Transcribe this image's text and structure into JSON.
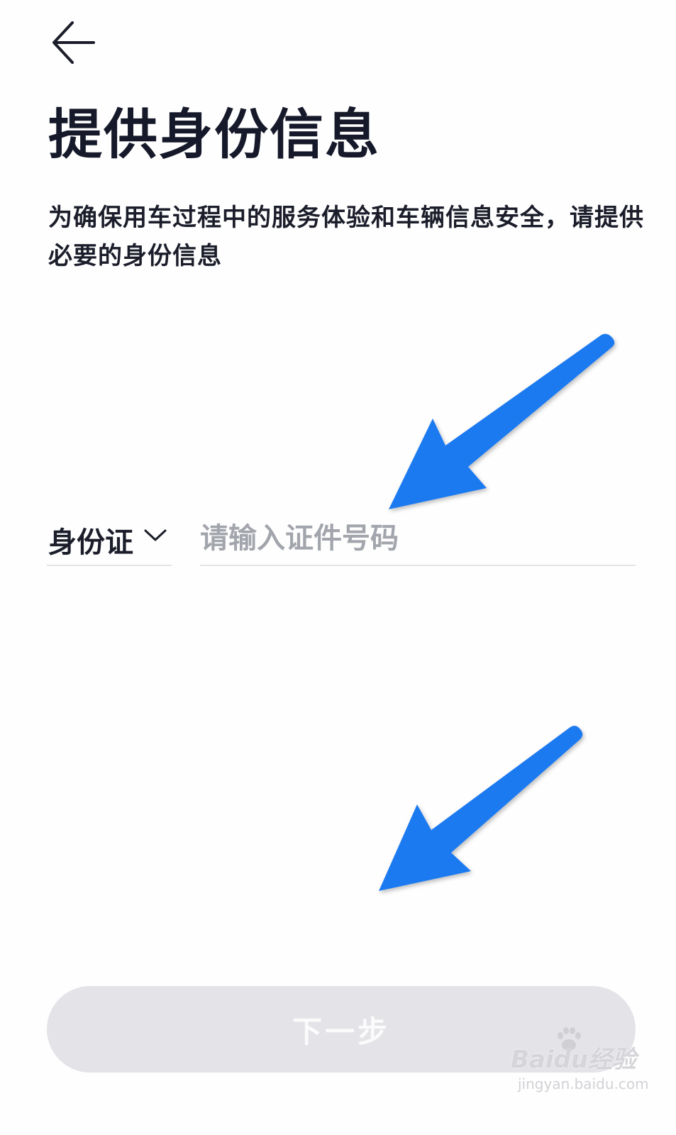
{
  "header": {
    "back_icon": "arrow-left-icon"
  },
  "title": "提供身份信息",
  "description": "为确保用车过程中的服务体验和车辆信息安全，请提供必要的身份信息",
  "form": {
    "id_type": {
      "selected": "身份证",
      "icon": "chevron-down-icon"
    },
    "id_number": {
      "value": "",
      "placeholder": "请输入证件号码"
    }
  },
  "next_button": {
    "label": "下一步"
  },
  "annotations": {
    "arrow_color": "#1f7af0"
  },
  "watermark": {
    "main": "Baidu经验",
    "sub": "jingyan.baidu.com"
  },
  "colors": {
    "title": "#16192a",
    "text": "#1b1d2a",
    "placeholder": "#a3a5ad",
    "divider": "#e3e3e6",
    "button_bg_disabled": "#e4e4e8"
  }
}
